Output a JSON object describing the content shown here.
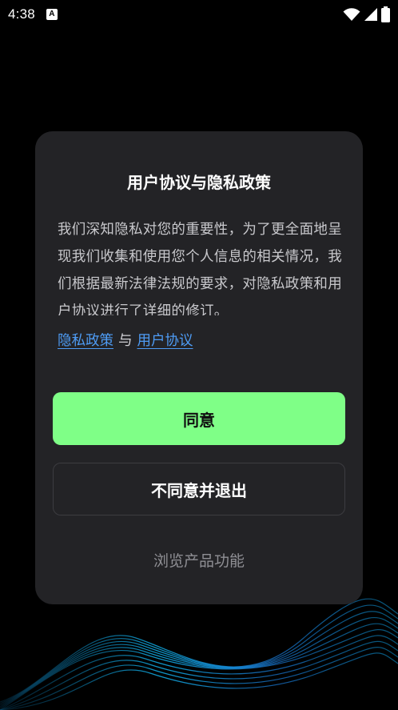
{
  "status_bar": {
    "time": "4:38",
    "notification_badge": "A"
  },
  "dialog": {
    "title": "用户协议与隐私政策",
    "body": "我们深知隐私对您的重要性，为了更全面地呈现我们收集和使用您个人信息的相关情况，我们根据最新法律法规的要求，对隐私政策和用户协议进行了详细的修订。",
    "privacy_link": "隐私政策",
    "link_separator": "与",
    "agreement_link": "用户协议",
    "agree_button": "同意",
    "disagree_button": "不同意并退出",
    "browse_link": "浏览产品功能"
  },
  "colors": {
    "accent_green": "#7fff87",
    "link_blue": "#4e9cf5",
    "dialog_bg": "#232326"
  }
}
